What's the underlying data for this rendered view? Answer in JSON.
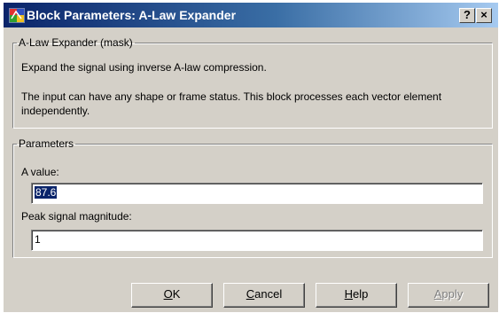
{
  "window": {
    "title": "Block Parameters: A-Law Expander",
    "help_glyph": "?",
    "close_glyph": "×",
    "icon": "simulink-block-icon"
  },
  "mask": {
    "legend": "A-Law Expander (mask)",
    "description_line1": "Expand the signal using inverse A-law compression.",
    "description_line2": "The input can have any shape or frame status. This block processes each vector element independently."
  },
  "parameters": {
    "legend": "Parameters",
    "a_value": {
      "label": "A value:",
      "value": "87.6",
      "selected": true
    },
    "peak_magnitude": {
      "label": "Peak signal magnitude:",
      "value": "1"
    }
  },
  "buttons": {
    "ok": {
      "mnemonic": "O",
      "rest": "K"
    },
    "cancel": {
      "mnemonic": "C",
      "rest": "ancel"
    },
    "help": {
      "mnemonic": "H",
      "rest": "elp"
    },
    "apply": {
      "mnemonic": "A",
      "rest": "pply",
      "enabled": false
    }
  },
  "colors": {
    "titlebar_start": "#0a246a",
    "titlebar_end": "#a6caf0",
    "face": "#d4d0c8",
    "selection": "#0a246a"
  }
}
